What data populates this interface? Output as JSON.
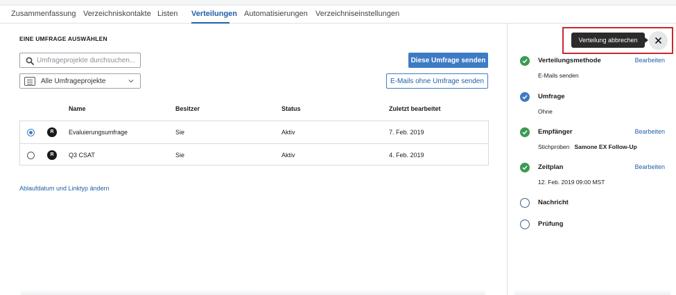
{
  "tabs": [
    {
      "label": "Zusammenfassung",
      "active": false
    },
    {
      "label": "Verzeichniskontakte",
      "active": false
    },
    {
      "label": "Listen",
      "active": false
    },
    {
      "label": "Verteilungen",
      "active": true
    },
    {
      "label": "Automatisierungen",
      "active": false
    },
    {
      "label": "Verzeichniseinstellungen",
      "active": false
    }
  ],
  "main": {
    "section_title": "EINE UMFRAGE AUSWÄHLEN",
    "search": {
      "placeholder": "Umfrageprojekte durchsuchen...",
      "value": "",
      "icon": "search-icon"
    },
    "filter": {
      "selected": "Alle Umfrageprojekte",
      "icon": "list-icon"
    },
    "buttons": {
      "send_survey": "Diese Umfrage senden",
      "send_without_survey": "E-Mails ohne Umfrage senden"
    },
    "table": {
      "columns": [
        "Name",
        "Besitzer",
        "Status",
        "Zuletzt bearbeitet"
      ],
      "rows": [
        {
          "selected": true,
          "badge": "R",
          "name": "Evaluierungsumfrage",
          "owner": "Sie",
          "status": "Aktiv",
          "edited": "7. Feb. 2019"
        },
        {
          "selected": false,
          "badge": "R",
          "name": "Q3 CSAT",
          "owner": "Sie",
          "status": "Aktiv",
          "edited": "4. Feb. 2019"
        }
      ]
    },
    "link": "Ablaufdatum und Linktyp ändern"
  },
  "sidebar": {
    "tooltip": "Verteilung abbrechen",
    "highlight_color": "#c9282d",
    "steps": [
      {
        "title": "Verteilungsmethode",
        "sub": "E-Mails senden",
        "edit": "Bearbeiten",
        "state": "complete"
      },
      {
        "title": "Umfrage",
        "sub": "Ohne",
        "edit": "",
        "state": "current"
      },
      {
        "title": "Empfänger",
        "sub_prefix": "Stichproben",
        "sub_bold": "Samone EX Follow-Up",
        "edit": "Bearbeiten",
        "state": "complete"
      },
      {
        "title": "Zeitplan",
        "sub": "12. Feb. 2019 09:00 MST",
        "edit": "Bearbeiten",
        "state": "complete"
      },
      {
        "title": "Nachricht",
        "state": "pending"
      },
      {
        "title": "Prüfung",
        "state": "pending"
      }
    ]
  },
  "colors": {
    "accent": "#3d7bc5",
    "link": "#1f5fa8",
    "complete": "#3b9a52"
  }
}
